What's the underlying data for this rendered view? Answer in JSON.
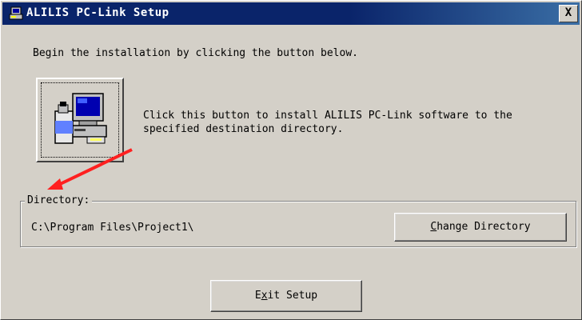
{
  "window": {
    "title": "ALILIS PC-Link Setup",
    "close_label": "X"
  },
  "intro_text": "Begin the installation by clicking the button below.",
  "install": {
    "description_line1": "Click this button to install ALILIS PC-Link software to the",
    "description_line2": "specified destination directory."
  },
  "directory": {
    "group_label": "Directory:",
    "path": "C:\\Program Files\\Project1\\",
    "change_button": {
      "mnemonic": "C",
      "rest": "hange Directory"
    }
  },
  "exit_button": {
    "prefix": "E",
    "mnemonic": "x",
    "rest": "it Setup"
  },
  "colors": {
    "face": "#d4d0c8",
    "title_bar": "#0a246a",
    "arrow": "#ff2020"
  },
  "icons": [
    "setup-app-icon",
    "close-icon",
    "installer-computer-icon",
    "red-arrow-annotation"
  ]
}
